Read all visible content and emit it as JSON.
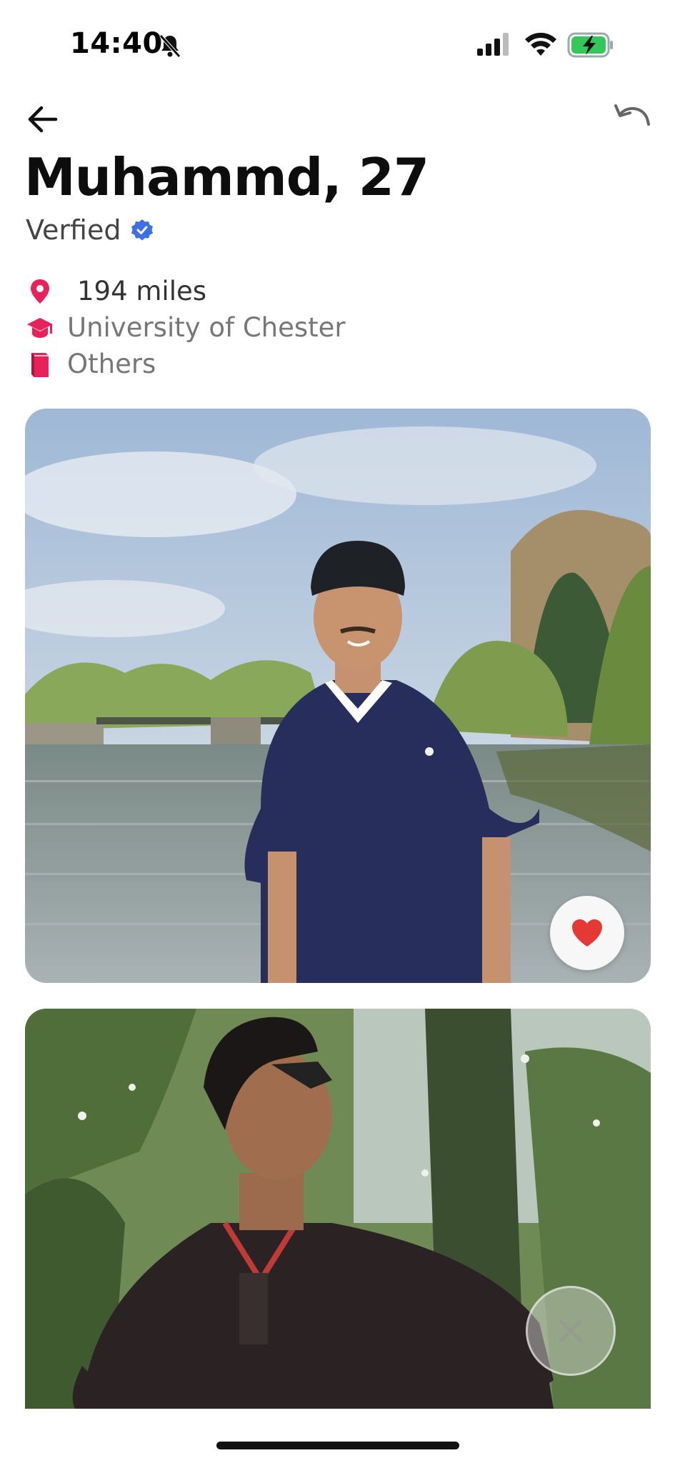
{
  "status_bar": {
    "time": "14:40",
    "icons": [
      "bell-slash-icon",
      "signal-icon",
      "wifi-icon",
      "battery-charging-icon"
    ]
  },
  "header": {
    "back_icon": "arrow-left-icon",
    "undo_icon": "undo-icon"
  },
  "profile": {
    "name_age": "Muhammd, 27",
    "verified_label": "Verfied",
    "details": [
      {
        "icon": "location-pin-icon",
        "text": "194 miles"
      },
      {
        "icon": "graduation-cap-icon",
        "text": "University of Chester"
      },
      {
        "icon": "book-icon",
        "text": "Others"
      }
    ]
  },
  "photos": [
    {
      "description_icon": "profile-photo-1",
      "overlay_button": "heart-icon"
    },
    {
      "description_icon": "profile-photo-2",
      "overlay_button": "close-icon"
    }
  ],
  "colors": {
    "accent": "#e8215a",
    "verified_blue": "#3f6fe6",
    "like_red": "#e53935"
  }
}
